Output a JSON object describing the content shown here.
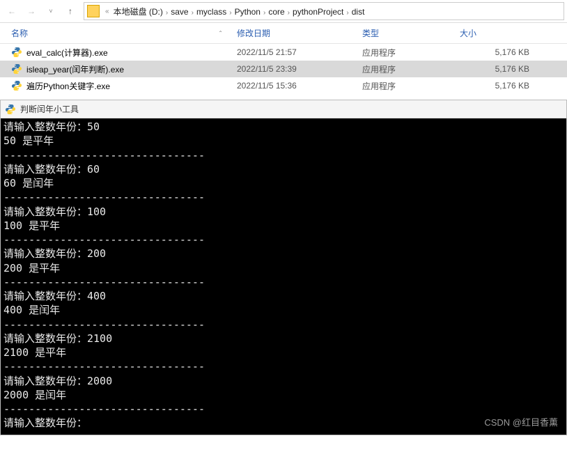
{
  "breadcrumb": {
    "prefix": "«",
    "items": [
      "本地磁盘 (D:)",
      "save",
      "myclass",
      "Python",
      "core",
      "pythonProject",
      "dist"
    ]
  },
  "headers": {
    "name": "名称",
    "date": "修改日期",
    "type": "类型",
    "size": "大小"
  },
  "files": [
    {
      "name": "eval_calc(计算器).exe",
      "date": "2022/11/5 21:57",
      "type": "应用程序",
      "size": "5,176 KB",
      "selected": false
    },
    {
      "name": "isleap_year(闰年判断).exe",
      "date": "2022/11/5 23:39",
      "type": "应用程序",
      "size": "5,176 KB",
      "selected": true
    },
    {
      "name": "遍历Python关键字.exe",
      "date": "2022/11/5 15:36",
      "type": "应用程序",
      "size": "5,176 KB",
      "selected": false
    }
  ],
  "console": {
    "title": "判断闰年小工具",
    "separator": "--------------------------------",
    "entries": [
      {
        "prompt": "请输入整数年份：",
        "input": "50",
        "result": "50 是平年"
      },
      {
        "prompt": "请输入整数年份：",
        "input": "60",
        "result": "60 是闰年"
      },
      {
        "prompt": "请输入整数年份：",
        "input": "100",
        "result": "100 是平年"
      },
      {
        "prompt": "请输入整数年份：",
        "input": "200",
        "result": "200 是平年"
      },
      {
        "prompt": "请输入整数年份：",
        "input": "400",
        "result": "400 是闰年"
      },
      {
        "prompt": "请输入整数年份：",
        "input": "2100",
        "result": "2100 是平年"
      },
      {
        "prompt": "请输入整数年份：",
        "input": "2000",
        "result": "2000 是闰年"
      }
    ],
    "final_prompt": "请输入整数年份：",
    "watermark": "CSDN @红目香薰"
  }
}
